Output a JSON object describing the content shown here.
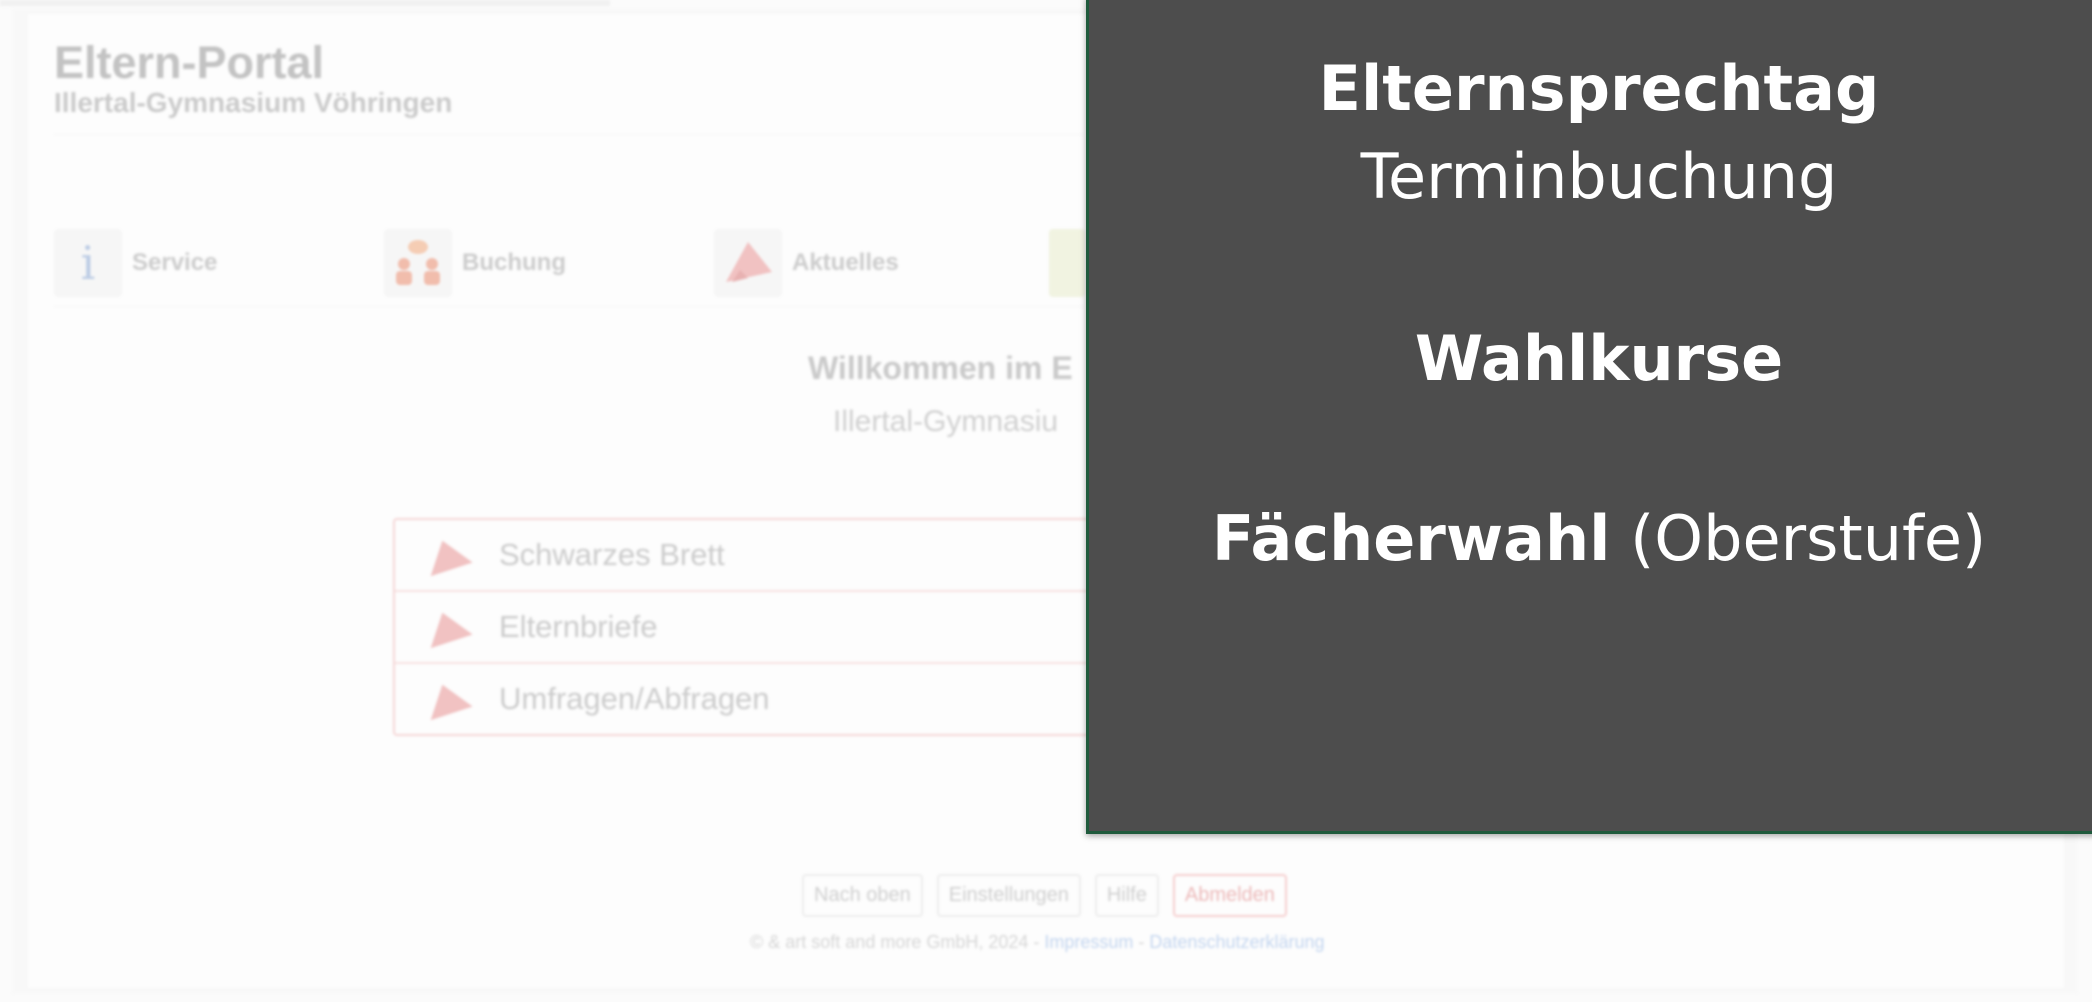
{
  "portal": {
    "title": "Eltern-Portal",
    "school": "Illertal-Gymnasium Vöhringen",
    "nav": [
      {
        "label": "Service"
      },
      {
        "label": "Buchung"
      },
      {
        "label": "Aktuelles"
      }
    ],
    "welcome_visible": "Willkommen im E",
    "welcome_sub_visible": "Illertal-Gymnasiu",
    "list": [
      {
        "label": "Schwarzes Brett"
      },
      {
        "label": "Elternbriefe"
      },
      {
        "label": "Umfragen/Abfragen"
      }
    ],
    "footer": {
      "links": [
        "Nach oben",
        "Einstellungen",
        "Hilfe",
        "Abmelden"
      ],
      "copyright": "© & art soft and more GmbH, 2024 - ",
      "impressum": "Impressum",
      "separator": " - ",
      "privacy": "Datenschutzerklärung"
    },
    "colors": {
      "info_icon": "#7f9fd0",
      "accent_red": "#e88a8a"
    },
    "icons": [
      "info-icon",
      "booking-people-icon",
      "megaphone-icon",
      "envelope-icon"
    ]
  },
  "panel": {
    "background": "#4d4d4d",
    "border": "#1f5a3c",
    "line1": "Elternsprechtag",
    "line2": "Terminbuchung",
    "line3": "Wahlkurse",
    "line4_bold": "Fächerwahl",
    "line4_normal": " (Oberstufe)"
  }
}
